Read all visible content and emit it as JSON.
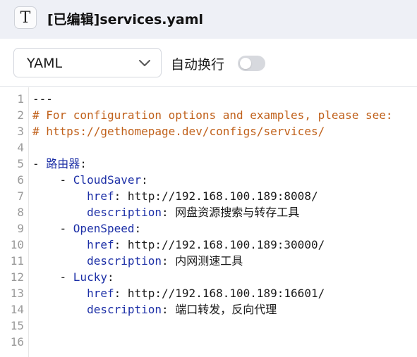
{
  "window": {
    "icon_glyph": "T",
    "title": "[已编辑]services.yaml"
  },
  "toolbar": {
    "language": "YAML",
    "wrap_label": "自动换行",
    "wrap_enabled": false
  },
  "editor": {
    "line_numbers": [
      "1",
      "2",
      "3",
      "4",
      "5",
      "6",
      "7",
      "8",
      "9",
      "10",
      "11",
      "12",
      "13",
      "14",
      "15",
      "16"
    ],
    "lines": [
      {
        "indent": "",
        "doc": "---"
      },
      {
        "indent": "",
        "comment": "# For configuration options and examples, please see:"
      },
      {
        "indent": "",
        "comment": "# https://gethomepage.dev/configs/services/"
      },
      {
        "indent": ""
      },
      {
        "indent": "",
        "dash": "- ",
        "key": "路由器",
        "colon": ":"
      },
      {
        "indent": "    ",
        "dash": "- ",
        "key": "CloudSaver",
        "colon": ":"
      },
      {
        "indent": "        ",
        "key": "href",
        "colon": ": ",
        "value": "http://192.168.100.189:8008/"
      },
      {
        "indent": "        ",
        "key": "description",
        "colon": ": ",
        "value": "网盘资源搜索与转存工具"
      },
      {
        "indent": "    ",
        "dash": "- ",
        "key": "OpenSpeed",
        "colon": ":"
      },
      {
        "indent": "        ",
        "key": "href",
        "colon": ": ",
        "value": "http://192.168.100.189:30000/"
      },
      {
        "indent": "        ",
        "key": "description",
        "colon": ": ",
        "value": "内网测速工具"
      },
      {
        "indent": "    ",
        "dash": "- ",
        "key": "Lucky",
        "colon": ":"
      },
      {
        "indent": "        ",
        "key": "href",
        "colon": ": ",
        "value": "http://192.168.100.189:16601/"
      },
      {
        "indent": "        ",
        "key": "description",
        "colon": ": ",
        "value": "端口转发，反向代理"
      },
      {
        "indent": ""
      },
      {
        "indent": ""
      }
    ]
  },
  "colors": {
    "titlebar_bg": "#eef0f6",
    "comment": "#c0601a",
    "key": "#1b2ea6",
    "toggle_off": "#d7d9de"
  },
  "icons": {
    "app": "text-editor-icon",
    "select_arrow": "chevron-down-icon"
  }
}
